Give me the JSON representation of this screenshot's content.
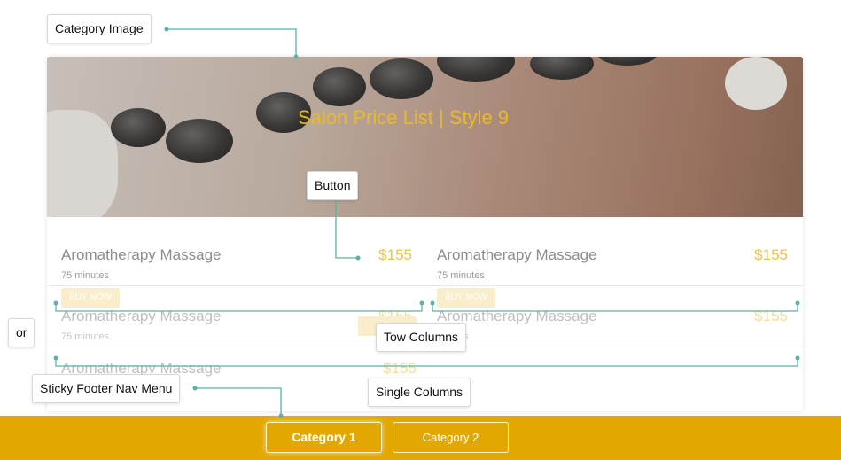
{
  "annotations": {
    "category_image": "Category Image",
    "button": "Button",
    "or": "or",
    "two_columns": "Tow Columns",
    "single_columns": "Single Columns",
    "sticky_footer": "Sticky Footer Nav Menu"
  },
  "hero": {
    "title": "Salon Price List | Style 9"
  },
  "items": [
    {
      "name": "Aromatherapy Massage",
      "price": "$155",
      "duration": "75 minutes"
    },
    {
      "name": "Aromatherapy Massage",
      "price": "$155",
      "duration": "75 minutes"
    },
    {
      "name": "Aromatherapy Massage",
      "price": "$155",
      "duration": "75 minutes"
    },
    {
      "name": "Aromatherapy Massage",
      "price": "$155",
      "duration": "es"
    },
    {
      "name": "Aromatherapy Massage",
      "price": "$155"
    }
  ],
  "buy_label": "BUY NOW",
  "buy_label_short": "B",
  "footer": {
    "tabs": [
      {
        "label": "Category 1",
        "active": true
      },
      {
        "label": "Category 2",
        "active": false
      }
    ]
  },
  "colors": {
    "accent": "#e3a800",
    "price": "#ecc248",
    "annotation_line": "#5ab3a8"
  }
}
